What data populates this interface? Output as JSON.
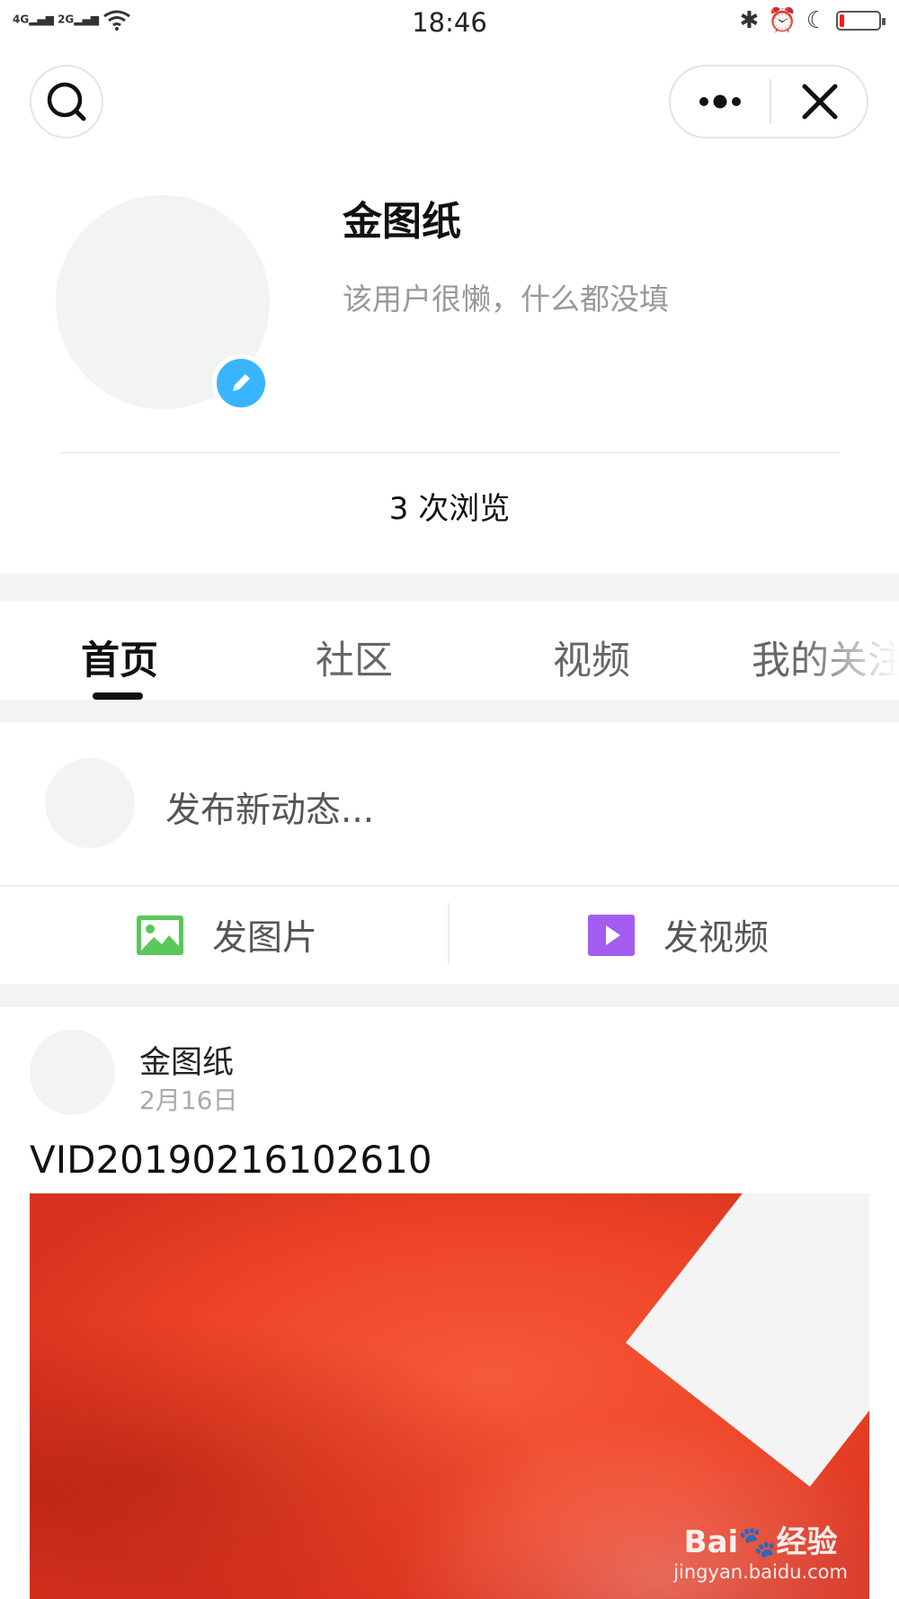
{
  "status_bar": {
    "signal_1": "4G",
    "signal_2": "2G",
    "time": "18:46",
    "battery_level": 0.12,
    "battery_color": "#ff1a1a"
  },
  "profile": {
    "name": "金图纸",
    "bio": "该用户很懒，什么都没填",
    "views": "3 次浏览",
    "edit_badge_color": "#39b5ff"
  },
  "tabs": [
    {
      "label": "首页",
      "active": true
    },
    {
      "label": "社区",
      "active": false
    },
    {
      "label": "视频",
      "active": false
    },
    {
      "label": "我的关注",
      "active": false
    }
  ],
  "composer": {
    "placeholder": "发布新动态...",
    "photo_label": "发图片",
    "photo_icon": "image-icon",
    "photo_icon_color": "#5ac85a",
    "video_label": "发视频",
    "video_icon": "play-icon",
    "video_icon_color": "#a45cf0"
  },
  "post": {
    "author": "金图纸",
    "date": "2月16日",
    "title": "VID20190216102610",
    "watermark_top": "Bai",
    "watermark_bottom": "jingyan.baidu.com",
    "watermark_brand": "经验"
  }
}
